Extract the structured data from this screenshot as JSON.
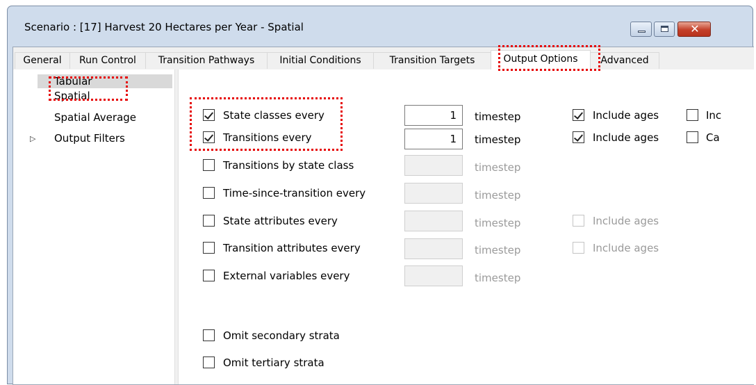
{
  "window": {
    "title": "Scenario : [17] Harvest 20 Hectares per Year - Spatial",
    "close_glyph": "✕"
  },
  "tabs": [
    "General",
    "Run Control",
    "Transition Pathways",
    "Initial Conditions",
    "Transition Targets",
    "Output Options",
    "Advanced"
  ],
  "active_tab": "Output Options",
  "nav": {
    "items": [
      "Tabular",
      "Spatial",
      "Spatial Average",
      "Output Filters"
    ],
    "selected": "Tabular",
    "expand_glyph": "▷"
  },
  "options": {
    "state_classes": {
      "label": "State classes every",
      "checked": true,
      "value": "1",
      "unit": "timestep",
      "ages_label": "Include ages",
      "ages_checked": true,
      "extra_label": "Inc"
    },
    "transitions": {
      "label": "Transitions every",
      "checked": true,
      "value": "1",
      "unit": "timestep",
      "ages_label": "Include ages",
      "ages_checked": true,
      "extra_label": "Ca"
    },
    "transitions_by_state_class": {
      "label": "Transitions by state class",
      "checked": false,
      "unit": "timestep"
    },
    "time_since_transition": {
      "label": "Time-since-transition every",
      "checked": false,
      "unit": "timestep"
    },
    "state_attributes": {
      "label": "State attributes every",
      "checked": false,
      "unit": "timestep",
      "ages_label": "Include ages"
    },
    "transition_attributes": {
      "label": "Transition attributes every",
      "checked": false,
      "unit": "timestep",
      "ages_label": "Include ages"
    },
    "external_variables": {
      "label": "External variables every",
      "checked": false,
      "unit": "timestep"
    },
    "omit_secondary": {
      "label": "Omit secondary strata",
      "checked": false
    },
    "omit_tertiary": {
      "label": "Omit tertiary strata",
      "checked": false
    }
  },
  "colors": {
    "highlight": "#e60000",
    "titlebar": "#cfdcec",
    "close_button": "#c4402a"
  }
}
